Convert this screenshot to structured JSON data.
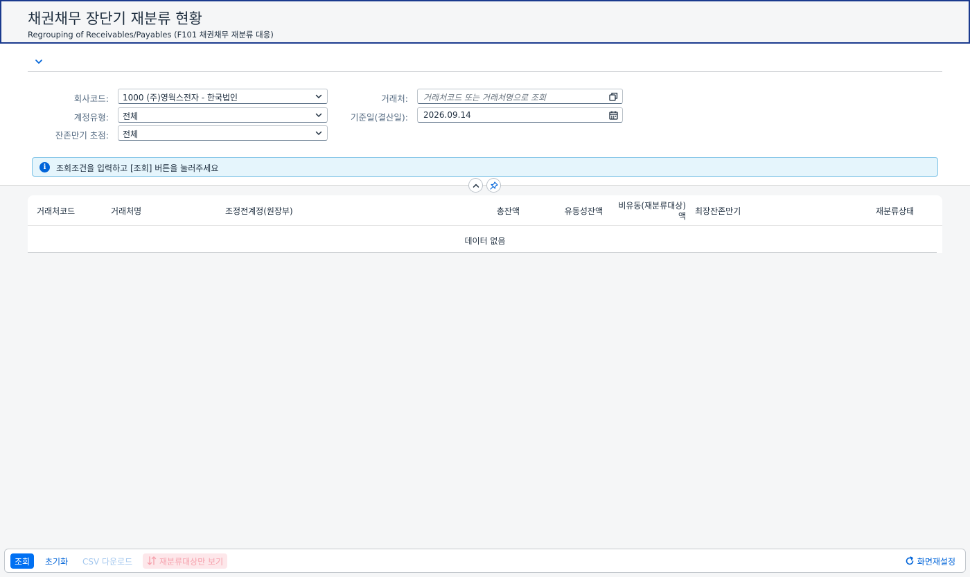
{
  "header": {
    "title": "채권채무 장단기 재분류 현황",
    "subtitle": "Regrouping of Receivables/Payables (F101 채권채무 재분류 대응)"
  },
  "filters": {
    "company_code": {
      "label": "회사코드:",
      "value": "1000 (주)영웍스전자 - 한국법인"
    },
    "account_type": {
      "label": "계정유형:",
      "value": "전체"
    },
    "remaining_focus": {
      "label": "잔존만기 초점:",
      "value": "전체"
    },
    "partner": {
      "label": "거래처:",
      "placeholder": "거래처코드 또는 거래처명으로 조회"
    },
    "base_date": {
      "label": "기준일(결산일):",
      "value": "2026.09.14"
    }
  },
  "message": {
    "text": "조회조건을 입력하고 [조회] 버튼을 눌러주세요"
  },
  "table": {
    "columns": [
      "거래처코드",
      "거래처명",
      "조정전계정(원장부)",
      "총잔액",
      "유동성잔액",
      "비유동(재분류대상)",
      "액",
      "최장잔존만기",
      "재분류상태"
    ],
    "no_data": "데이터 없음"
  },
  "footer": {
    "search_label": "조회",
    "reset_label": "초기화",
    "csv_label": "CSV 다운로드",
    "reclass_only_label": "재분류대상만 보기",
    "screen_reset_label": "화면재설정"
  },
  "icons": {
    "expand": "chevron-down-icon",
    "collapse": "chevron-up-icon",
    "pin": "pin-icon",
    "value_help": "value-help-icon",
    "calendar": "calendar-icon",
    "info": "info-icon",
    "sort": "sort-icon",
    "refresh": "refresh-icon"
  },
  "colors": {
    "brand": "#0070f2",
    "header_border": "#1a3a8e",
    "info_bg": "#e5f5fc"
  }
}
